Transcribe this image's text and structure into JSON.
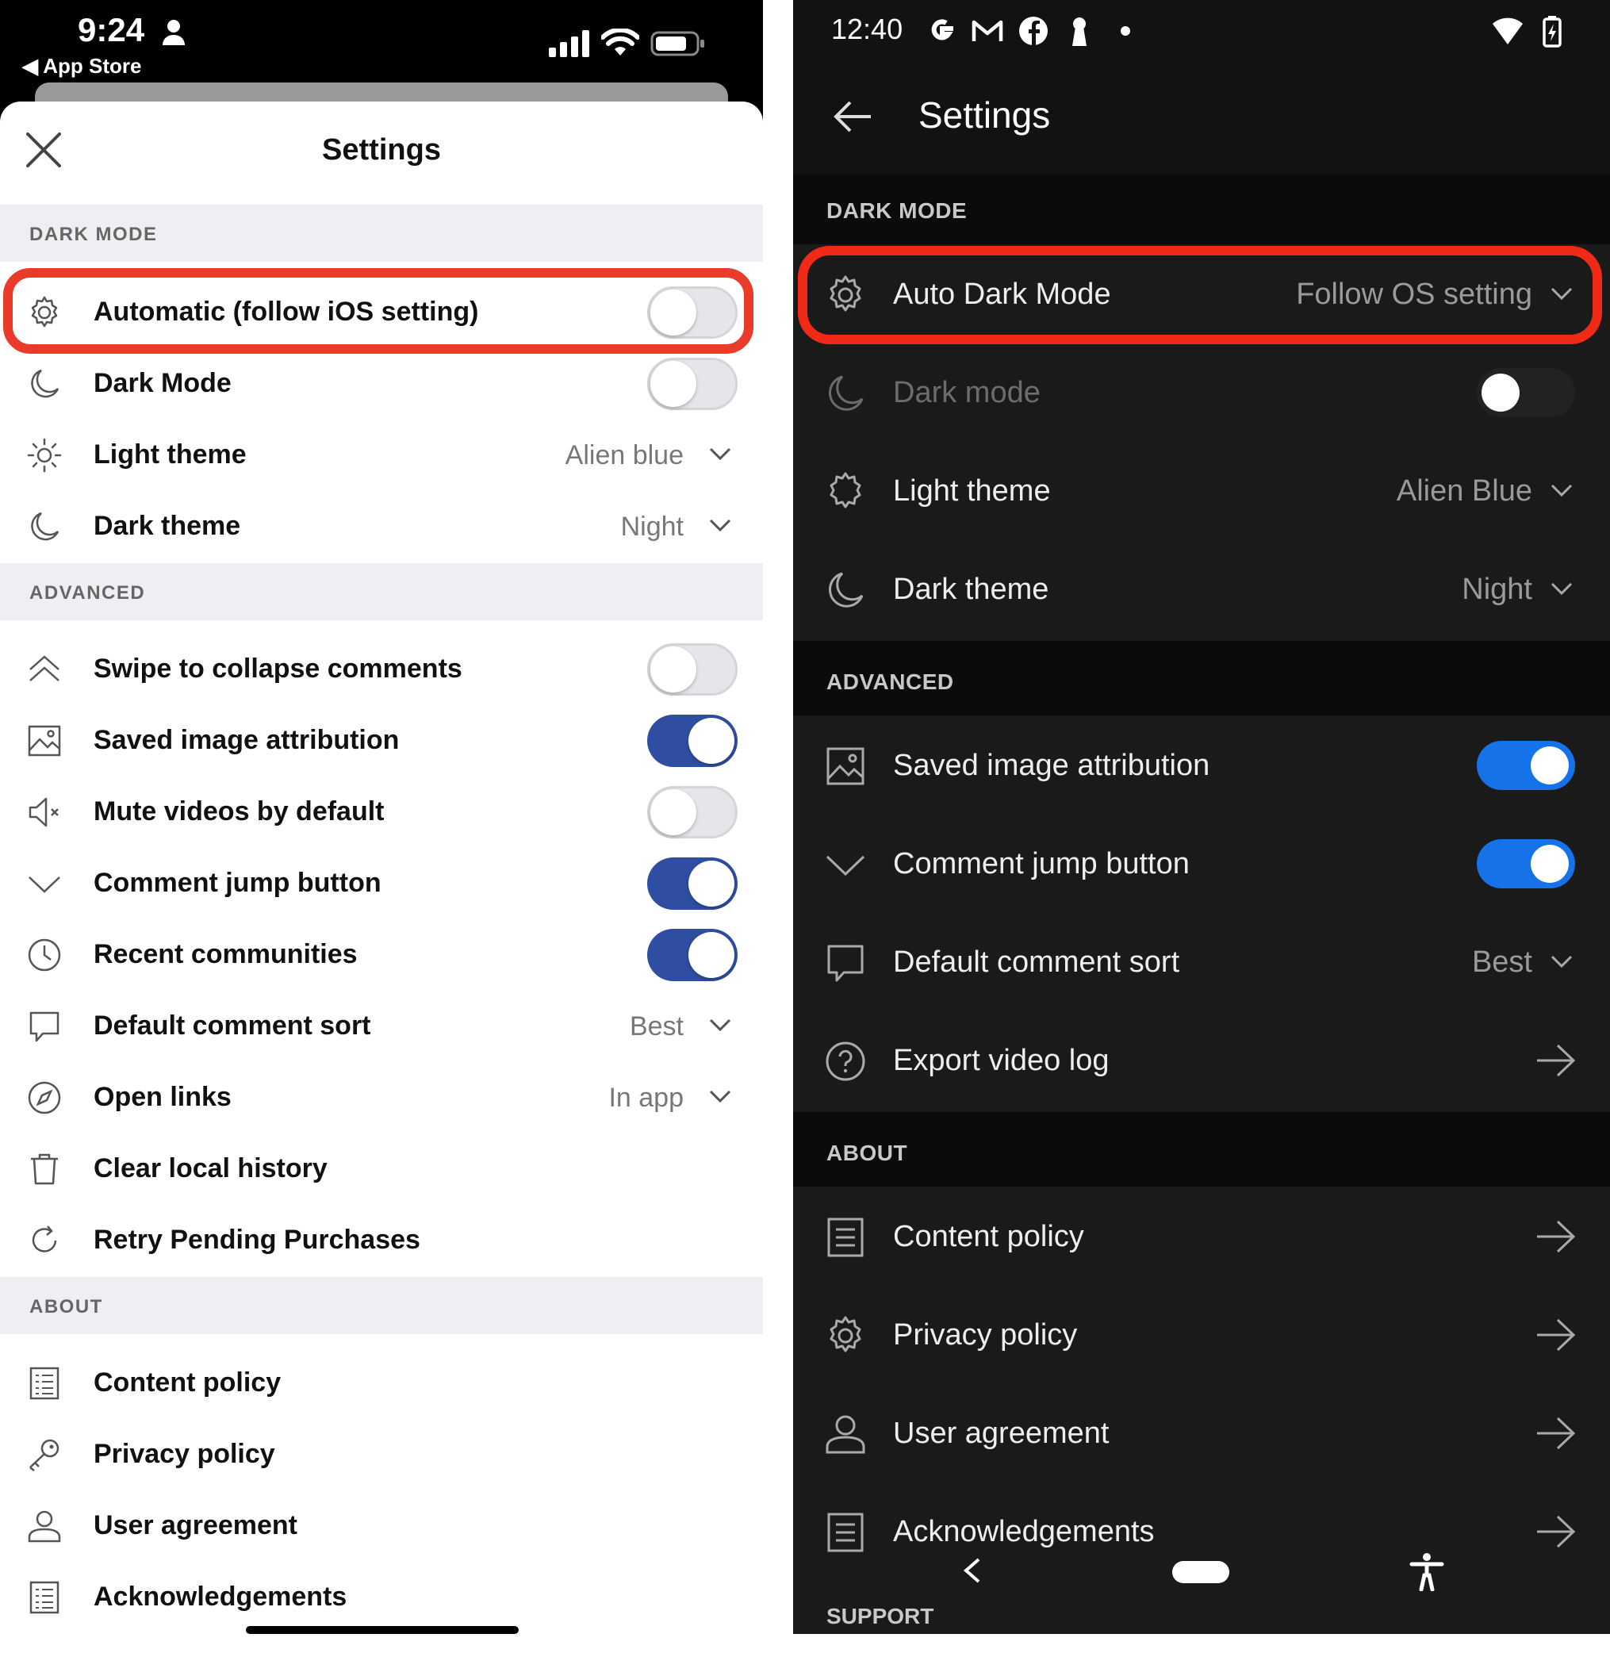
{
  "ios": {
    "status": {
      "time": "9:24",
      "back_label": "◀ App Store"
    },
    "title": "Settings",
    "sections": {
      "dark_mode": "DARK MODE",
      "advanced": "ADVANCED",
      "about": "ABOUT"
    },
    "dark_mode_rows": [
      {
        "label": "Automatic (follow iOS setting)",
        "icon": "gear-icon",
        "toggle": false
      },
      {
        "label": "Dark Mode",
        "icon": "moon-icon",
        "toggle": false
      },
      {
        "label": "Light theme",
        "icon": "sun-icon",
        "value": "Alien blue"
      },
      {
        "label": "Dark theme",
        "icon": "moon-icon",
        "value": "Night"
      }
    ],
    "advanced_rows": [
      {
        "label": "Swipe to collapse comments",
        "icon": "double-chevron-up-icon",
        "toggle": false
      },
      {
        "label": "Saved image attribution",
        "icon": "image-icon",
        "toggle": true
      },
      {
        "label": "Mute videos by default",
        "icon": "muted-speaker-icon",
        "toggle": false
      },
      {
        "label": "Comment jump button",
        "icon": "chevron-down-icon",
        "toggle": true
      },
      {
        "label": "Recent communities",
        "icon": "clock-icon",
        "toggle": true
      },
      {
        "label": "Default comment sort",
        "icon": "comment-icon",
        "value": "Best"
      },
      {
        "label": "Open links",
        "icon": "compass-icon",
        "value": "In app"
      },
      {
        "label": "Clear local history",
        "icon": "trash-icon"
      },
      {
        "label": "Retry Pending Purchases",
        "icon": "refresh-icon"
      }
    ],
    "about_rows": [
      {
        "label": "Content policy",
        "icon": "list-document-icon"
      },
      {
        "label": "Privacy policy",
        "icon": "key-icon"
      },
      {
        "label": "User agreement",
        "icon": "person-icon"
      },
      {
        "label": "Acknowledgements",
        "icon": "list-document-icon"
      }
    ]
  },
  "android": {
    "status": {
      "time": "12:40"
    },
    "title": "Settings",
    "sections": {
      "dark_mode": "DARK MODE",
      "advanced": "ADVANCED",
      "about": "ABOUT",
      "support": "SUPPORT"
    },
    "dark_mode_rows": [
      {
        "label": "Auto Dark Mode",
        "icon": "gear-icon",
        "value": "Follow OS setting"
      },
      {
        "label": "Dark mode",
        "icon": "moon-icon",
        "toggle": false,
        "disabled": true
      },
      {
        "label": "Light theme",
        "icon": "sun-icon",
        "value": "Alien Blue"
      },
      {
        "label": "Dark theme",
        "icon": "moon-icon",
        "value": "Night"
      }
    ],
    "advanced_rows": [
      {
        "label": "Saved image attribution",
        "icon": "image-icon",
        "toggle": true
      },
      {
        "label": "Comment jump button",
        "icon": "chevron-down-icon",
        "toggle": true
      },
      {
        "label": "Default comment sort",
        "icon": "comment-icon",
        "value": "Best"
      },
      {
        "label": "Export video log",
        "icon": "help-circle-icon",
        "arrow": true
      }
    ],
    "about_rows": [
      {
        "label": "Content policy",
        "icon": "document-icon",
        "arrow": true
      },
      {
        "label": "Privacy policy",
        "icon": "gear-icon",
        "arrow": true
      },
      {
        "label": "User agreement",
        "icon": "person-icon",
        "arrow": true
      },
      {
        "label": "Acknowledgements",
        "icon": "document-icon",
        "arrow": true
      }
    ]
  },
  "colors": {
    "highlight_red": "#ea3b2a",
    "ios_toggle_on": "#2f4ea2",
    "android_toggle_on": "#1672e8",
    "android_bg": "#121212"
  }
}
